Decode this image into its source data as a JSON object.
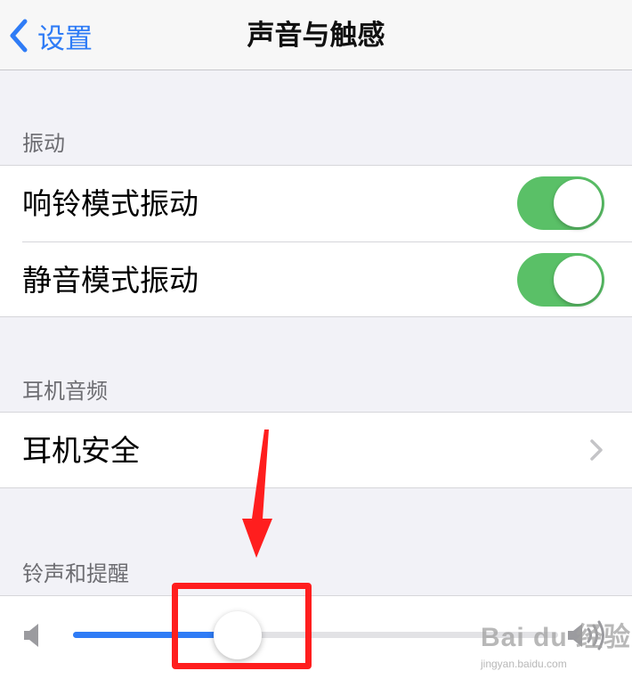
{
  "nav": {
    "back_label": "设置",
    "title": "声音与触感"
  },
  "sections": {
    "vibration": {
      "header": "振动",
      "rows": [
        {
          "label": "响铃模式振动",
          "toggle_on": true
        },
        {
          "label": "静音模式振动",
          "toggle_on": true
        }
      ]
    },
    "headphone_audio": {
      "header": "耳机音频",
      "rows": [
        {
          "label": "耳机安全"
        }
      ]
    },
    "ringer_alerts": {
      "header": "铃声和提醒",
      "volume_level": 0.34
    }
  },
  "colors": {
    "accent": "#2f7cf6",
    "toggle_on": "#5ac067",
    "annotation_red": "#ff1e1e",
    "group_bg": "#f2f2f7"
  },
  "icons": {
    "back": "chevron-left-icon",
    "disclosure": "chevron-right-icon",
    "volume_min": "speaker-low-icon",
    "volume_max": "speaker-high-icon"
  },
  "watermark": {
    "main": "Bai du 经验",
    "sub": "jingyan.baidu.com"
  }
}
